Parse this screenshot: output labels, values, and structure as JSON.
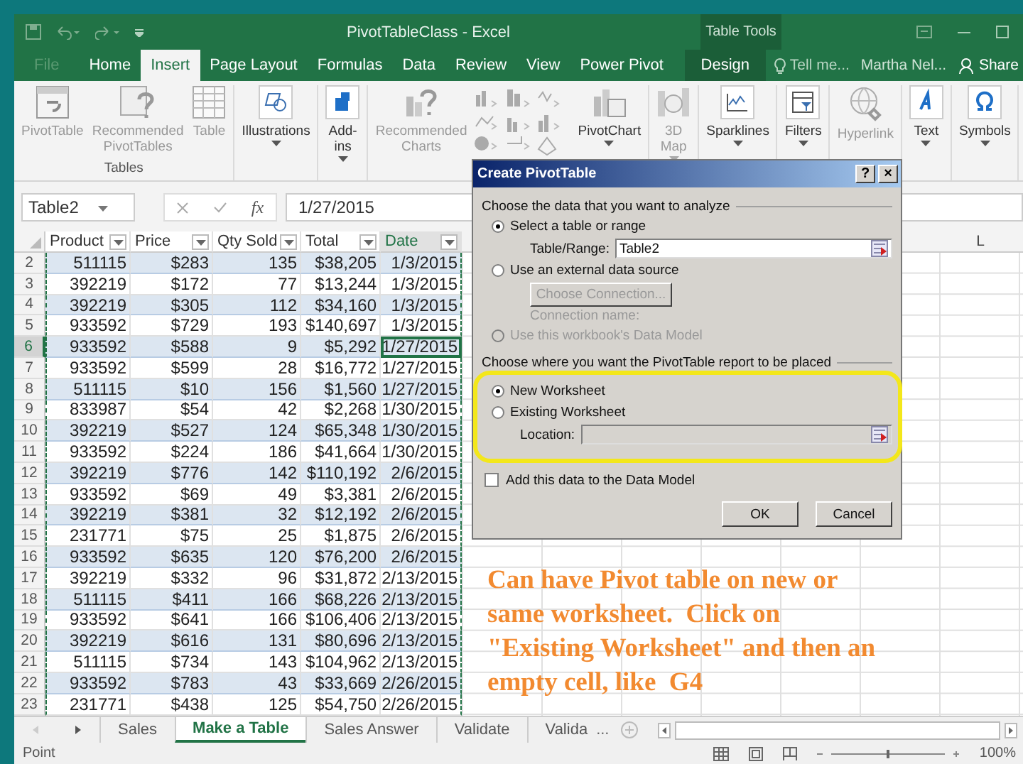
{
  "title_bar": {
    "title": "PivotTableClass - Excel",
    "context_label": "Table Tools"
  },
  "tabs": [
    {
      "label": "File",
      "selected": false,
      "kind": "file"
    },
    {
      "label": "Home",
      "selected": false,
      "kind": "tab"
    },
    {
      "label": "Insert",
      "selected": true,
      "kind": "tab"
    },
    {
      "label": "Page Layout",
      "selected": false,
      "kind": "tab"
    },
    {
      "label": "Formulas",
      "selected": false,
      "kind": "tab"
    },
    {
      "label": "Data",
      "selected": false,
      "kind": "tab"
    },
    {
      "label": "Review",
      "selected": false,
      "kind": "tab"
    },
    {
      "label": "View",
      "selected": false,
      "kind": "tab"
    },
    {
      "label": "Power Pivot",
      "selected": false,
      "kind": "tab"
    },
    {
      "label": "Design",
      "selected": false,
      "kind": "contextual"
    }
  ],
  "tell_me": "Tell me...",
  "user": "Martha Nel...",
  "share": "Share",
  "ribbon": {
    "groups": [
      {
        "label": "Tables",
        "items": [
          {
            "kind": "button",
            "label": "PivotTable",
            "disabled": true,
            "dropdown": false
          },
          {
            "kind": "button",
            "label": "Recommended\nPivotTables",
            "disabled": true,
            "dropdown": false
          },
          {
            "kind": "button",
            "label": "Table",
            "disabled": true,
            "dropdown": false
          }
        ]
      },
      {
        "items": [
          {
            "kind": "button",
            "label": "Illustrations",
            "disabled": false,
            "dropdown": true
          }
        ]
      },
      {
        "items": [
          {
            "kind": "button",
            "label": "Add-\nins",
            "disabled": false,
            "dropdown": true
          }
        ]
      },
      {
        "items": [
          {
            "kind": "button",
            "label": "Recommended\nCharts",
            "disabled": true,
            "dropdown": false
          },
          {
            "kind": "gallery"
          },
          {
            "kind": "button",
            "label": "PivotChart",
            "disabled": false,
            "dropdown": true
          }
        ]
      },
      {
        "items": [
          {
            "kind": "button",
            "label": "3D\nMap",
            "disabled": true,
            "dropdown": true
          }
        ]
      },
      {
        "items": [
          {
            "kind": "button",
            "label": "Sparklines",
            "disabled": false,
            "dropdown": true
          }
        ]
      },
      {
        "items": [
          {
            "kind": "button",
            "label": "Filters",
            "disabled": false,
            "dropdown": true
          }
        ]
      },
      {
        "items": [
          {
            "kind": "button",
            "label": "Hyperlink",
            "disabled": true,
            "dropdown": false
          }
        ]
      },
      {
        "items": [
          {
            "kind": "button",
            "label": "Text",
            "disabled": false,
            "dropdown": true
          }
        ]
      },
      {
        "items": [
          {
            "kind": "button",
            "label": "Symbols",
            "disabled": false,
            "dropdown": true
          }
        ]
      }
    ]
  },
  "formula_bar": {
    "name_box": "Table2",
    "function_button": "fx",
    "value": "1/27/2015"
  },
  "table": {
    "columns": [
      "Product",
      "Price",
      "Qty Sold",
      "Total",
      "Date"
    ],
    "far_column_letter": "L",
    "rows": [
      {
        "n": "2",
        "cells": [
          "511115",
          "$283",
          "135",
          "$38,205",
          "1/3/2015"
        ],
        "selected": false
      },
      {
        "n": "3",
        "cells": [
          "392219",
          "$172",
          "77",
          "$13,244",
          "1/3/2015"
        ],
        "selected": false
      },
      {
        "n": "4",
        "cells": [
          "392219",
          "$305",
          "112",
          "$34,160",
          "1/3/2015"
        ],
        "selected": false
      },
      {
        "n": "5",
        "cells": [
          "933592",
          "$729",
          "193",
          "$140,697",
          "1/3/2015"
        ],
        "selected": false
      },
      {
        "n": "6",
        "cells": [
          "933592",
          "$588",
          "9",
          "$5,292",
          "1/27/2015"
        ],
        "selected": true
      },
      {
        "n": "7",
        "cells": [
          "933592",
          "$599",
          "28",
          "$16,772",
          "1/27/2015"
        ],
        "selected": false
      },
      {
        "n": "8",
        "cells": [
          "511115",
          "$10",
          "156",
          "$1,560",
          "1/27/2015"
        ],
        "selected": false
      },
      {
        "n": "9",
        "cells": [
          "833987",
          "$54",
          "42",
          "$2,268",
          "1/30/2015"
        ],
        "selected": false
      },
      {
        "n": "10",
        "cells": [
          "392219",
          "$527",
          "124",
          "$65,348",
          "1/30/2015"
        ],
        "selected": false
      },
      {
        "n": "11",
        "cells": [
          "933592",
          "$224",
          "186",
          "$41,664",
          "1/30/2015"
        ],
        "selected": false
      },
      {
        "n": "12",
        "cells": [
          "392219",
          "$776",
          "142",
          "$110,192",
          "2/6/2015"
        ],
        "selected": false
      },
      {
        "n": "13",
        "cells": [
          "933592",
          "$69",
          "49",
          "$3,381",
          "2/6/2015"
        ],
        "selected": false
      },
      {
        "n": "14",
        "cells": [
          "392219",
          "$381",
          "32",
          "$12,192",
          "2/6/2015"
        ],
        "selected": false
      },
      {
        "n": "15",
        "cells": [
          "231771",
          "$75",
          "25",
          "$1,875",
          "2/6/2015"
        ],
        "selected": false
      },
      {
        "n": "16",
        "cells": [
          "933592",
          "$635",
          "120",
          "$76,200",
          "2/6/2015"
        ],
        "selected": false
      },
      {
        "n": "17",
        "cells": [
          "392219",
          "$332",
          "96",
          "$31,872",
          "2/13/2015"
        ],
        "selected": false
      },
      {
        "n": "18",
        "cells": [
          "511115",
          "$411",
          "166",
          "$68,226",
          "2/13/2015"
        ],
        "selected": false
      },
      {
        "n": "19",
        "cells": [
          "933592",
          "$641",
          "166",
          "$106,406",
          "2/13/2015"
        ],
        "selected": false
      },
      {
        "n": "20",
        "cells": [
          "392219",
          "$616",
          "131",
          "$80,696",
          "2/13/2015"
        ],
        "selected": false
      },
      {
        "n": "21",
        "cells": [
          "511115",
          "$734",
          "143",
          "$104,962",
          "2/13/2015"
        ],
        "selected": false
      },
      {
        "n": "22",
        "cells": [
          "933592",
          "$783",
          "43",
          "$33,669",
          "2/26/2015"
        ],
        "selected": false
      },
      {
        "n": "23",
        "cells": [
          "231771",
          "$438",
          "125",
          "$54,750",
          "2/26/2015"
        ],
        "selected": false
      }
    ]
  },
  "dialog": {
    "title": "Create PivotTable",
    "help": "?",
    "close": "×",
    "section_1": "Choose the data that you want to analyze",
    "source_options": [
      {
        "label": "Select a table or range",
        "selected": true,
        "disabled": false
      },
      {
        "label": "Use an external data source",
        "selected": false,
        "disabled": false
      }
    ],
    "range_label": "Table/Range:",
    "range_value": "Table2",
    "connection_button": "Choose Connection...",
    "connection_label": "Connection name:",
    "data_model_option": {
      "label": "Use this workbook's Data Model",
      "selected": false,
      "disabled": true
    },
    "section_2": "Choose where you want the PivotTable report to be placed",
    "placement_options": [
      {
        "label": "New Worksheet",
        "selected": true
      },
      {
        "label": "Existing Worksheet",
        "selected": false
      }
    ],
    "location_label": "Location:",
    "add_to_model": {
      "label": "Add this data to the Data Model",
      "checked": false
    },
    "buttons": [
      "OK",
      "Cancel"
    ]
  },
  "sheet_tabs": [
    {
      "label": "Sales",
      "selected": false
    },
    {
      "label": "Make a Table",
      "selected": true
    },
    {
      "label": "Sales Answer",
      "selected": false
    },
    {
      "label": "Validate",
      "selected": false
    },
    {
      "label": "Valida",
      "selected": false
    }
  ],
  "more_sheets": "...",
  "status_bar": {
    "mode": "Point",
    "zoom": "100%",
    "zoom_slider": {
      "level": 0.5
    }
  },
  "annotation": [
    "Can have Pivot table on new or",
    "same worksheet.  Click on",
    "\"Existing Worksheet\" and then an",
    "empty cell, like  G4"
  ]
}
